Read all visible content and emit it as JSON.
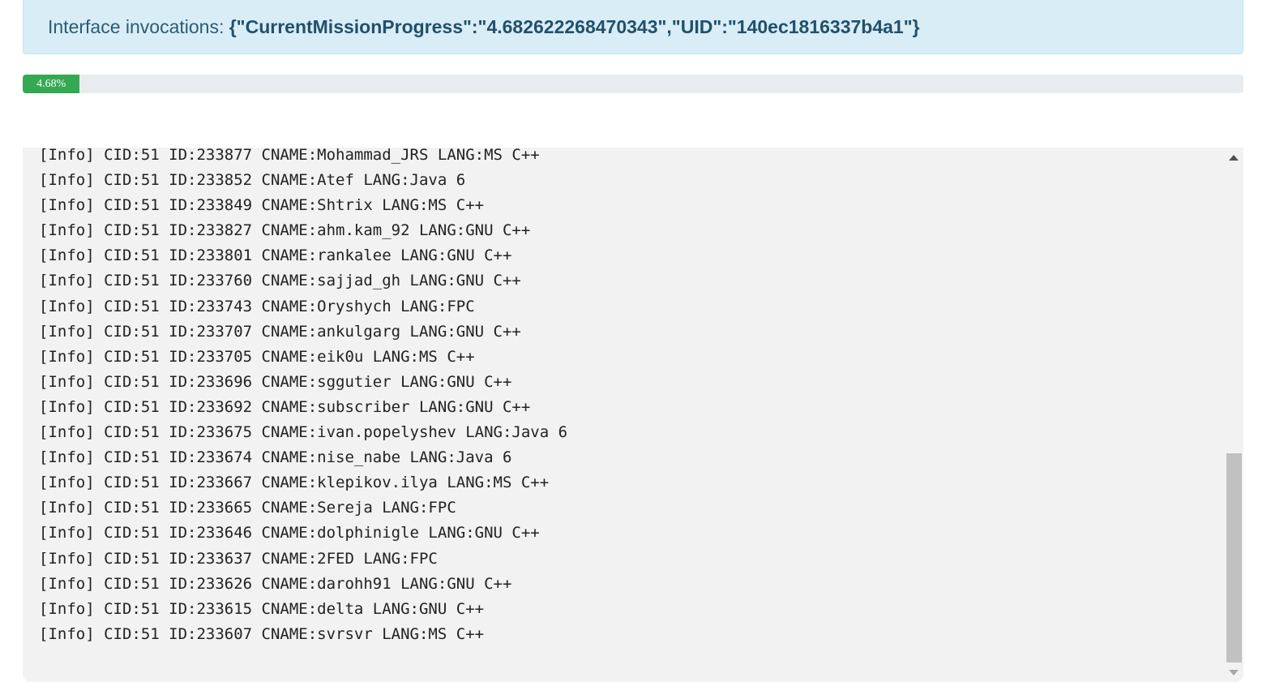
{
  "alert": {
    "label": "Interface invocations: ",
    "payload": "{\"CurrentMissionProgress\":\"4.682622268470343\",\"UID\":\"140ec1816337b4a1\"}",
    "background_color": "#d9edf7",
    "text_color": "#31708f"
  },
  "progress": {
    "label": "4.68%",
    "percent": 4.68,
    "bar_color": "#35a853"
  },
  "log": {
    "lines": [
      "[Info] CID:51 ID:233877 CNAME:Mohammad_JRS LANG:MS C++",
      "[Info] CID:51 ID:233852 CNAME:Atef LANG:Java 6",
      "[Info] CID:51 ID:233849 CNAME:Shtrix LANG:MS C++",
      "[Info] CID:51 ID:233827 CNAME:ahm.kam_92 LANG:GNU C++",
      "[Info] CID:51 ID:233801 CNAME:rankalee LANG:GNU C++",
      "[Info] CID:51 ID:233760 CNAME:sajjad_gh LANG:GNU C++",
      "[Info] CID:51 ID:233743 CNAME:Oryshych LANG:FPC",
      "[Info] CID:51 ID:233707 CNAME:ankulgarg LANG:GNU C++",
      "[Info] CID:51 ID:233705 CNAME:eik0u LANG:MS C++",
      "[Info] CID:51 ID:233696 CNAME:sggutier LANG:GNU C++",
      "[Info] CID:51 ID:233692 CNAME:subscriber LANG:GNU C++",
      "[Info] CID:51 ID:233675 CNAME:ivan.popelyshev LANG:Java 6",
      "[Info] CID:51 ID:233674 CNAME:nise_nabe LANG:Java 6",
      "[Info] CID:51 ID:233667 CNAME:klepikov.ilya LANG:MS C++",
      "[Info] CID:51 ID:233665 CNAME:Sereja LANG:FPC",
      "[Info] CID:51 ID:233646 CNAME:dolphinigle LANG:GNU C++",
      "[Info] CID:51 ID:233637 CNAME:2FED LANG:FPC",
      "[Info] CID:51 ID:233626 CNAME:darohh91 LANG:GNU C++",
      "[Info] CID:51 ID:233615 CNAME:delta LANG:GNU C++",
      "[Info] CID:51 ID:233607 CNAME:svrsvr LANG:MS C++"
    ]
  },
  "scrollbar": {
    "up_icon": "arrow-up-icon",
    "down_icon": "arrow-down-icon"
  }
}
